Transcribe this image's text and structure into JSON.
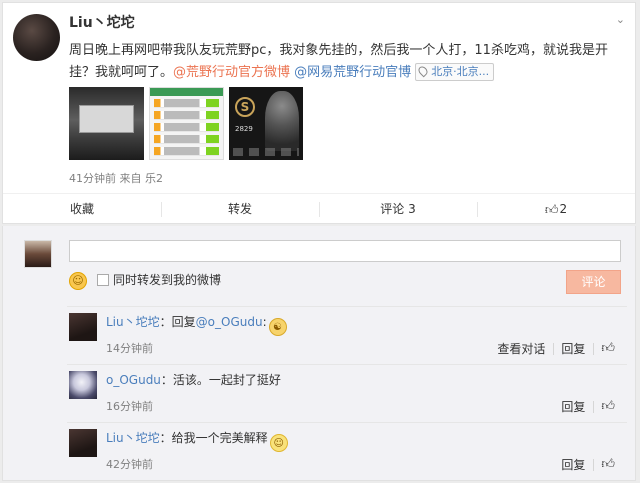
{
  "post": {
    "username": "Liu丶坨坨",
    "text_main": "周日晚上再网吧带我队友玩荒野pc，我对象先挂的，然后我一个人打，11杀吃鸡，就说我是开挂？我就呵呵了。",
    "mention1": "@荒野行动官方微博",
    "mention2": "@网易荒野行动官博",
    "location": "北京·北京...",
    "thumb3_badge": "S",
    "thumb3_number": "2829",
    "meta": "41分钟前 来自 乐2"
  },
  "actions": {
    "favorite": "收藏",
    "repost": "转发",
    "comment": "评论 3",
    "like_count": "2"
  },
  "composer": {
    "placeholder": "",
    "repost_option": "同时转发到我的微博",
    "submit": "评论"
  },
  "comments": [
    {
      "name": "Liu丶坨坨",
      "prefix": "：回复",
      "mention": "@o_OGudu",
      "suffix": ":",
      "time": "14分钟前",
      "op1": "查看对话",
      "op2": "回复"
    },
    {
      "name": "o_OGudu",
      "text": "：活该。一起封了挺好",
      "time": "16分钟前",
      "op2": "回复"
    },
    {
      "name": "Liu丶坨坨",
      "text": "：给我一个完美解释",
      "time": "42分钟前",
      "op2": "回复"
    }
  ],
  "icons": {
    "more": "chevron-down-icon",
    "location": "map-pin-icon",
    "like": "thumbs-up-icon",
    "emoji": "smiley-icon"
  },
  "colors": {
    "accent_link": "#eb7350",
    "blue_link": "#4a7ebc",
    "submit_bg": "#f7b8a0"
  }
}
